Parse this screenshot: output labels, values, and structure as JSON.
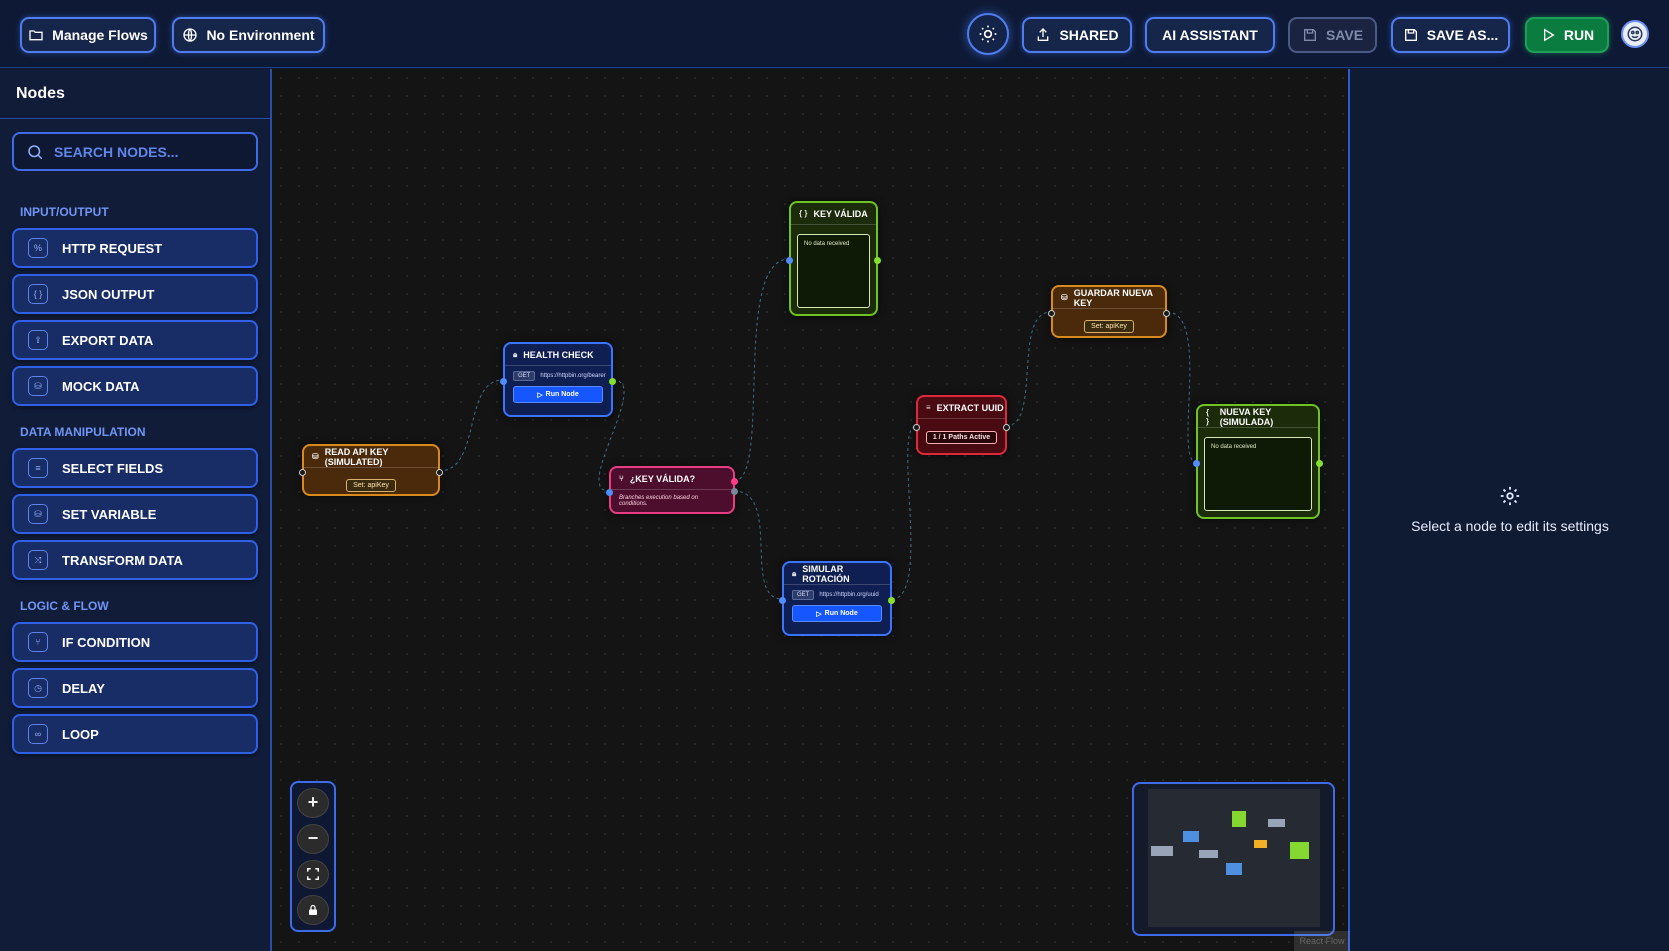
{
  "topbar": {
    "manage_flows": "Manage Flows",
    "no_environment": "No Environment",
    "shared": "SHARED",
    "ai_assistant": "AI ASSISTANT",
    "save": "SAVE",
    "save_as": "SAVE AS...",
    "run": "RUN"
  },
  "sidebar": {
    "title": "Nodes",
    "search_placeholder": "SEARCH NODES...",
    "sections": [
      {
        "label": "INPUT/OUTPUT",
        "items": [
          "HTTP REQUEST",
          "JSON OUTPUT",
          "EXPORT DATA",
          "MOCK DATA"
        ]
      },
      {
        "label": "DATA MANIPULATION",
        "items": [
          "SELECT FIELDS",
          "SET VARIABLE",
          "TRANSFORM DATA"
        ]
      },
      {
        "label": "LOGIC & FLOW",
        "items": [
          "IF CONDITION",
          "DELAY",
          "LOOP"
        ]
      }
    ]
  },
  "flow": {
    "read_api_key": {
      "title": "READ API KEY (SIMULATED)",
      "tag": "Set: apiKey"
    },
    "health_check": {
      "title": "HEALTH CHECK",
      "method": "GET",
      "url": "https://httpbin.org/bearer",
      "run": "Run Node"
    },
    "key_valida_cond": {
      "title": "¿KEY VÁLIDA?",
      "desc": "Branches execution based on conditions."
    },
    "key_valida": {
      "title": "KEY VÁLIDA",
      "data": "No data received"
    },
    "simular_rotacion": {
      "title": "SIMULAR ROTACIÓN",
      "method": "GET",
      "url": "https://httpbin.org/uuid",
      "run": "Run Node"
    },
    "extract_uuid": {
      "title": "EXTRACT UUID",
      "tag": "1 / 1 Paths Active"
    },
    "guardar_nueva_key": {
      "title": "GUARDAR NUEVA KEY",
      "tag": "Set: apiKey"
    },
    "nueva_key": {
      "title": "NUEVA KEY (SIMULADA)",
      "data": "No data received"
    }
  },
  "canvas": {
    "attribution": "React Flow"
  },
  "right_panel": {
    "empty_text": "Select a node to edit its settings"
  },
  "colors": {
    "accent": "#3e6ce8",
    "run": "#0b7c3f",
    "canvas": "#141414"
  }
}
